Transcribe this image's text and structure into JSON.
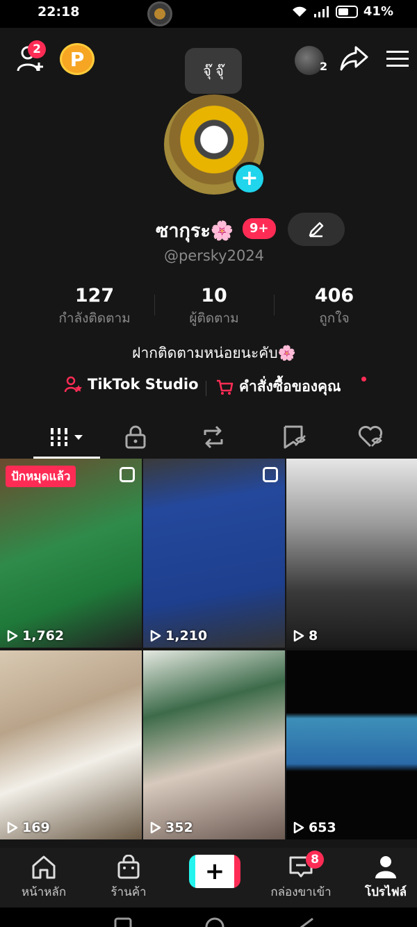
{
  "status_bar": {
    "time": "22:18",
    "battery": "41%"
  },
  "top_bar": {
    "add_friend_badge": "2",
    "points_label": "P",
    "tooltip": "จุ๊ จุ๊",
    "account_count": "2"
  },
  "profile": {
    "display_name": "ซากุระ",
    "name_emoji": "🌸",
    "name_badge": "9+",
    "username": "@persky2024",
    "bio": "ฝากติดตามหน่อยนะคับ🌸"
  },
  "stats": [
    {
      "value": "127",
      "label": "กำลังติดตาม"
    },
    {
      "value": "10",
      "label": "ผู้ติดตาม"
    },
    {
      "value": "406",
      "label": "ถูกใจ"
    }
  ],
  "links": {
    "studio": "TikTok Studio",
    "orders": "คำสั่งซื้อของคุณ"
  },
  "tabs": [
    "videos",
    "private",
    "reposts",
    "favorites",
    "liked"
  ],
  "videos": [
    {
      "views": "1,762",
      "badge": "ปักหมุดแล้ว",
      "multi": true,
      "bg": "linear-gradient(160deg,#6b4a2e 0%,#2f8b4a 45%,#1f7a3a 70%,#222 100%)"
    },
    {
      "views": "1,210",
      "badge": "",
      "multi": true,
      "bg": "linear-gradient(170deg,#3a3a3a 0%,#24489c 25%,#1e3f8d 70%,#333 100%)"
    },
    {
      "views": "8",
      "badge": "",
      "multi": false,
      "bg": "linear-gradient(180deg,#e6e6e6 0%,#9a9a9a 35%,#3a3a3a 70%,#1a1a1a 100%)"
    },
    {
      "views": "169",
      "badge": "",
      "multi": false,
      "bg": "linear-gradient(160deg,#d9c9b2 0%,#b9a48a 35%,#f2efe8 60%,#6a5a46 100%)"
    },
    {
      "views": "352",
      "badge": "",
      "multi": false,
      "bg": "linear-gradient(165deg,#e4e8e0 0%,#3d6b4a 30%,#d8c9bd 60%,#6a5a52 100%)"
    },
    {
      "views": "653",
      "badge": "",
      "multi": false,
      "bg": "linear-gradient(180deg,#050505 0%,#050505 33%,#3d8fb8 36%,#2a6aa8 60%,#050505 64%,#050505 100%)"
    }
  ],
  "bottom_nav": {
    "home": "หน้าหลัก",
    "shop": "ร้านค้า",
    "inbox": "กล่องขาเข้า",
    "inbox_badge": "8",
    "profile": "โปรไฟล์"
  },
  "colors": {
    "accent": "#fe2c55",
    "cyan": "#25f4ee",
    "background": "#161616"
  }
}
